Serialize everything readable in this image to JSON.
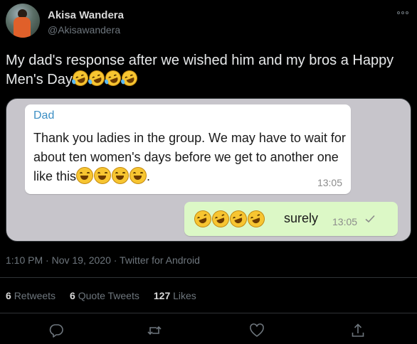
{
  "author": {
    "display_name": "Akisa Wandera",
    "handle": "@Akisawandera"
  },
  "icons": {
    "more": "more-icon",
    "reply": "reply-icon",
    "retweet": "retweet-icon",
    "like": "heart-icon",
    "share": "share-icon",
    "check": "check-icon"
  },
  "tweet": {
    "text": "My dad's response after we wished him and my bros a Happy Men's Day",
    "emoji": "rolling-on-floor-laughing x4"
  },
  "chat": {
    "incoming": {
      "sender": "Dad",
      "message": "Thank you ladies in the group. We may have to wait for about ten women's days before we get to another one like this",
      "trailing": ".",
      "time": "13:05",
      "emoji": "grinning-face x4"
    },
    "outgoing": {
      "message": "surely",
      "time": "13:05",
      "emoji": "beaming-face x4"
    }
  },
  "meta": {
    "timestamp": "1:10 PM · Nov 19, 2020 · Twitter for Android"
  },
  "stats": {
    "retweets_count": "6",
    "retweets_label": "Retweets",
    "quote_count": "6",
    "quote_label": "Quote Tweets",
    "likes_count": "127",
    "likes_label": "Likes"
  },
  "colors": {
    "background": "#000000",
    "chat_background": "#c7c5cb",
    "incoming_bubble": "#ffffff",
    "outgoing_bubble": "#dcf8c6",
    "sender_name": "#3d8fc4",
    "muted": "#6e767d"
  }
}
